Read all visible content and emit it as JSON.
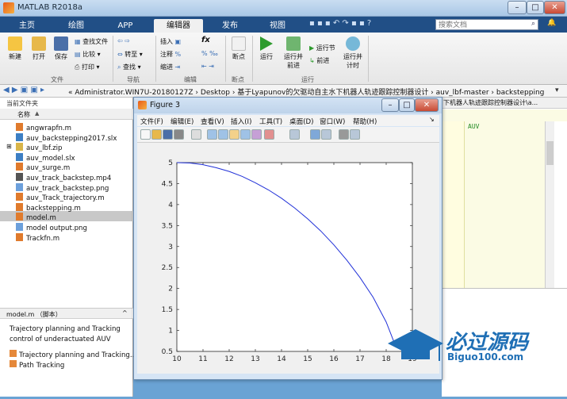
{
  "window": {
    "title": "MATLAB R2018a"
  },
  "tabs": [
    {
      "label": "主页",
      "active": false
    },
    {
      "label": "绘图",
      "active": false
    },
    {
      "label": "APP",
      "active": false
    },
    {
      "label": "编辑器",
      "active": true
    },
    {
      "label": "发布",
      "active": false
    },
    {
      "label": "视图",
      "active": false
    }
  ],
  "search": {
    "placeholder": "搜索文档"
  },
  "ribbon": {
    "file": {
      "section": "文件",
      "new": "新建",
      "open": "打开",
      "save": "保存",
      "find_files": "查找文件",
      "compare": "比较",
      "print": "打印"
    },
    "navigate": {
      "section": "导航",
      "goto": "转至",
      "find": "查找"
    },
    "edit": {
      "section": "编辑",
      "insert": "插入",
      "comment": "注释",
      "indent": "缩进",
      "fx": "fx"
    },
    "breakpoints": {
      "section": "断点",
      "label": "断点"
    },
    "run": {
      "section": "运行",
      "run": "运行",
      "run_advance_l1": "运行并",
      "run_advance_l2": "前进",
      "run_section": "运行节",
      "advance": "前进",
      "run_time_l1": "运行并",
      "run_time_l2": "计时"
    }
  },
  "address": {
    "path": "« Administrator.WIN7U-20180127Z › Desktop › 基于Lyapunov的欠驱动自主水下机器人轨迹跟踪控制器设计 › auv_lbf-master › backstepping"
  },
  "current_folder": {
    "title": "当前文件夹",
    "column": "名称",
    "sort_indicator": "▲",
    "files": [
      {
        "name": "angwrapfn.m",
        "type": "m"
      },
      {
        "name": "auv_backstepping2017.slx",
        "type": "slx"
      },
      {
        "name": "auv_lbf.zip",
        "type": "zip"
      },
      {
        "name": "auv_model.slx",
        "type": "slx"
      },
      {
        "name": "auv_surge.m",
        "type": "m"
      },
      {
        "name": "auv_track_backstep.mp4",
        "type": "mp4"
      },
      {
        "name": "auv_track_backstep.png",
        "type": "png"
      },
      {
        "name": "auv_Track_trajectory.m",
        "type": "m"
      },
      {
        "name": "backstepping.m",
        "type": "m"
      },
      {
        "name": "model.m",
        "type": "m"
      },
      {
        "name": "model output.png",
        "type": "png"
      },
      {
        "name": "Trackfn.m",
        "type": "m"
      }
    ],
    "selected_index": 9
  },
  "details": {
    "header": "model.m （脚本）",
    "desc_line1": "Trajectory planning and Tracking",
    "desc_line2": "control of underactuated AUV",
    "items": [
      "Trajectory planning and Tracking...",
      "Path Tracking"
    ]
  },
  "editor": {
    "tab_title": "下机器人轨迹跟踪控制器设计\\a...",
    "code_snippet": "AUV"
  },
  "figure": {
    "title": "Figure 3",
    "menus": [
      "文件(F)",
      "编辑(E)",
      "查看(V)",
      "插入(I)",
      "工具(T)",
      "桌面(D)",
      "窗口(W)",
      "帮助(H)"
    ]
  },
  "chart_data": {
    "type": "line",
    "x_ticks": [
      10,
      11,
      12,
      13,
      14,
      15,
      16,
      17,
      18,
      19
    ],
    "y_ticks": [
      0.5,
      1,
      1.5,
      2,
      2.5,
      3,
      3.5,
      4,
      4.5,
      5
    ],
    "xlim": [
      10,
      19
    ],
    "ylim": [
      0.5,
      5
    ],
    "series": [
      {
        "color": "#2030d8",
        "x": [
          10,
          10.5,
          11,
          11.5,
          12,
          12.5,
          13,
          13.5,
          14,
          14.5,
          15,
          15.5,
          16,
          16.5,
          17,
          17.5,
          18,
          18.3
        ],
        "y": [
          5.0,
          4.99,
          4.95,
          4.88,
          4.79,
          4.67,
          4.52,
          4.35,
          4.15,
          3.92,
          3.66,
          3.37,
          3.04,
          2.67,
          2.26,
          1.79,
          1.2,
          0.72
        ]
      }
    ]
  },
  "watermark": {
    "text": "必过源码",
    "url": "Biguo100.com"
  }
}
